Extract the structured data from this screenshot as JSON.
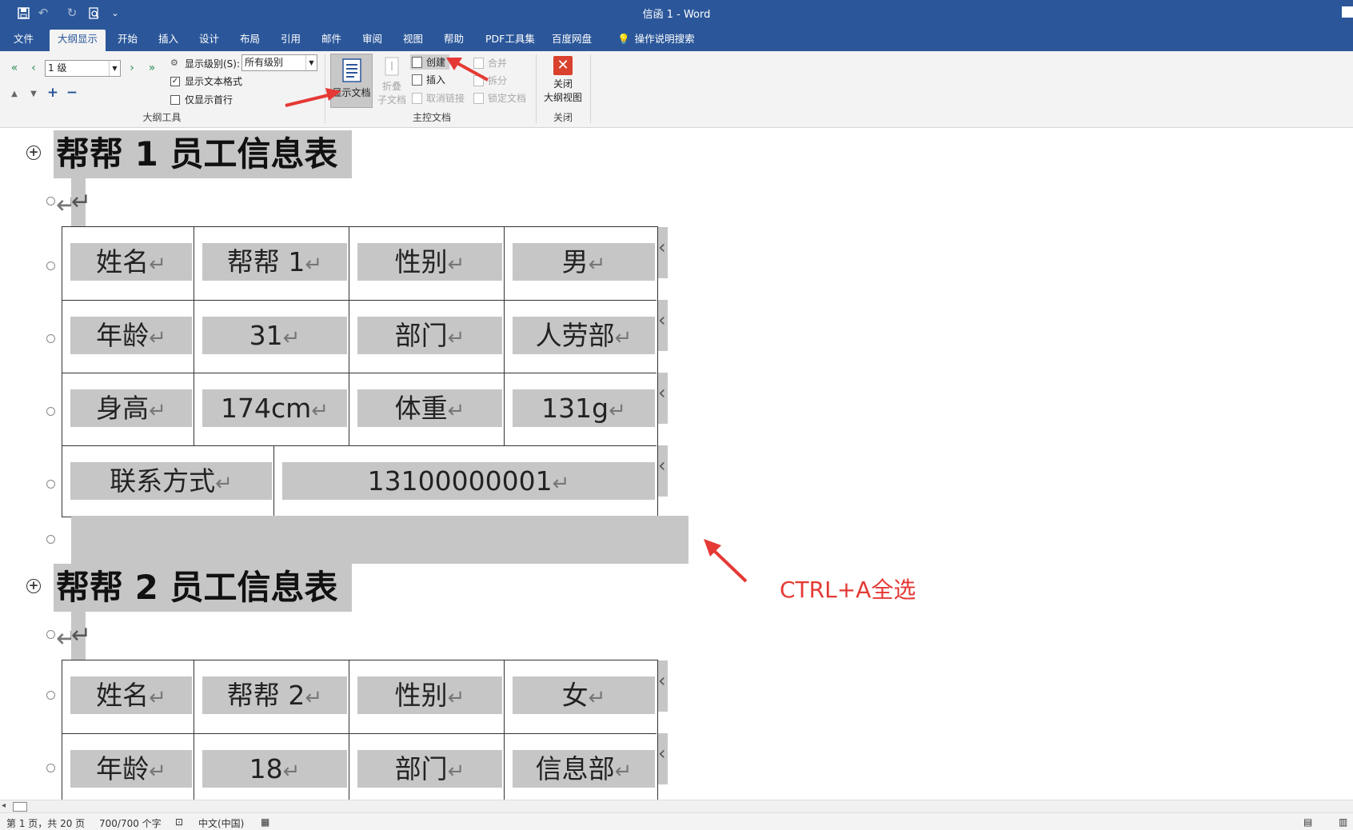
{
  "window": {
    "title": "信函 1  -  Word"
  },
  "quick_access": {
    "icons": [
      "save-icon",
      "undo-icon",
      "redo-icon",
      "print-preview-icon",
      "customize-icon"
    ],
    "glyphs": [
      "💾",
      "↶",
      "↻",
      "🔍",
      "⌄"
    ]
  },
  "tabs": [
    {
      "label": "文件"
    },
    {
      "label": "大纲显示",
      "active": true
    },
    {
      "label": "开始"
    },
    {
      "label": "插入"
    },
    {
      "label": "设计"
    },
    {
      "label": "布局"
    },
    {
      "label": "引用"
    },
    {
      "label": "邮件"
    },
    {
      "label": "审阅"
    },
    {
      "label": "视图"
    },
    {
      "label": "帮助"
    },
    {
      "label": "PDF工具集"
    },
    {
      "label": "百度网盘"
    },
    {
      "label": "操作说明搜索"
    }
  ],
  "ribbon": {
    "outline_tools": {
      "group_label": "大纲工具",
      "level_value": "1 级",
      "show_level_label": "显示级别(S):",
      "show_level_value": "所有级别",
      "show_text_format_label": "显示文本格式",
      "show_text_format_checked": true,
      "first_line_only_label": "仅显示首行",
      "first_line_only_checked": false,
      "arrows": [
        "«",
        "‹",
        "›",
        "»",
        "▲",
        "▼",
        "+",
        "−"
      ]
    },
    "master_document": {
      "group_label": "主控文档",
      "show_document_label": "显示文档",
      "collapse_label_1": "折叠",
      "collapse_label_2": "子文档",
      "create_label": "创建",
      "insert_label": "插入",
      "unlink_label": "取消链接",
      "merge_label": "合并",
      "split_label": "拆分",
      "lock_label": "锁定文档"
    },
    "close": {
      "group_label": "关闭",
      "close_label_1": "关闭",
      "close_label_2": "大纲视图",
      "icon_glyph": "✕"
    }
  },
  "document": {
    "return_mark": "↵",
    "plus_glyph": "+",
    "sections": [
      {
        "heading": "帮帮 1 员工信息表",
        "rows": [
          [
            "姓名",
            "帮帮 1",
            "性别",
            "男"
          ],
          [
            "年龄",
            "31",
            "部门",
            "人劳部"
          ],
          [
            "身高",
            "174cm",
            "体重",
            "131g"
          ],
          [
            "联系方式",
            "13100000001"
          ]
        ]
      },
      {
        "heading": "帮帮 2 员工信息表",
        "rows": [
          [
            "姓名",
            "帮帮 2",
            "性别",
            "女"
          ],
          [
            "年龄",
            "18",
            "部门",
            "信息部"
          ]
        ]
      }
    ]
  },
  "annotation": {
    "text": "CTRL+A全选",
    "color": "#e53935"
  },
  "status": {
    "page": "第 1 页，共 20 页",
    "words": "700/700 个字",
    "language": "中文(中国)"
  },
  "colors": {
    "accent": "#2b579a",
    "selection": "#c6c6c6",
    "close_button": "#d9412e"
  }
}
